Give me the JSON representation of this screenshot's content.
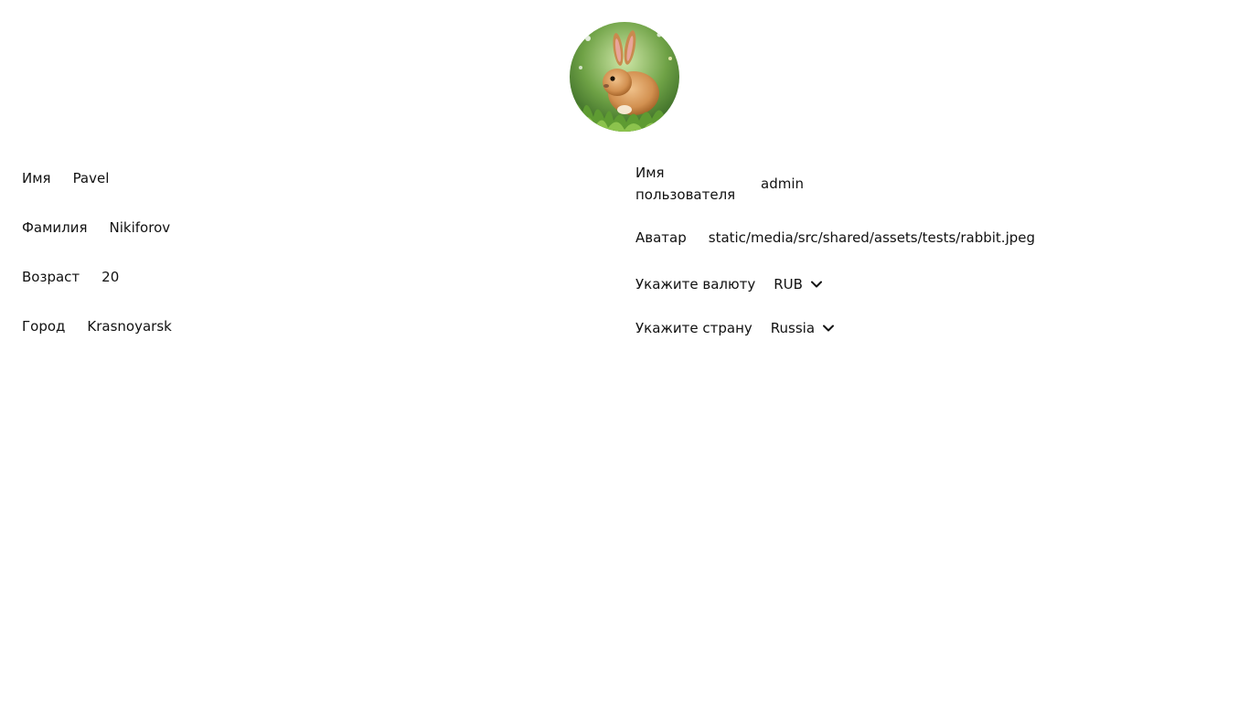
{
  "profile": {
    "avatar_alt": "rabbit",
    "first_name": {
      "label": "Имя",
      "value": "Pavel"
    },
    "last_name": {
      "label": "Фамилия",
      "value": "Nikiforov"
    },
    "age": {
      "label": "Возраст",
      "value": "20"
    },
    "city": {
      "label": "Город",
      "value": "Krasnoyarsk"
    },
    "username": {
      "label": "Имя пользователя",
      "value": "admin"
    },
    "avatar": {
      "label": "Аватар",
      "value": "static/media/src/shared/assets/tests/rabbit.jpeg"
    },
    "currency": {
      "label": "Укажите валюту",
      "value": "RUB"
    },
    "country": {
      "label": "Укажите страну",
      "value": "Russia"
    }
  },
  "icons": {
    "currency_dropdown": "chevron-down-icon",
    "country_dropdown": "chevron-down-icon"
  }
}
